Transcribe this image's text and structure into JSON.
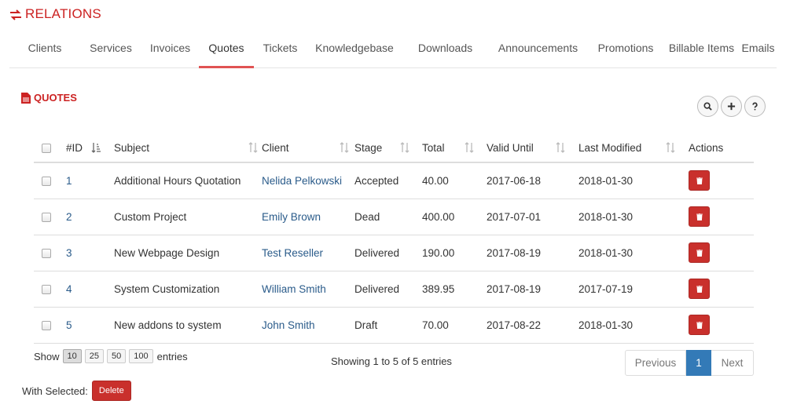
{
  "header": {
    "title": "RELATIONS",
    "icon": "exchange-icon",
    "accent": "#cc2222"
  },
  "tabs": [
    {
      "label": "Clients"
    },
    {
      "label": "Services"
    },
    {
      "label": "Invoices"
    },
    {
      "label": "Quotes",
      "active": true
    },
    {
      "label": "Tickets"
    },
    {
      "label": "Knowledgebase"
    },
    {
      "label": "Downloads"
    },
    {
      "label": "Announcements"
    },
    {
      "label": "Promotions"
    },
    {
      "label": "Billable Items"
    },
    {
      "label": "Emails"
    }
  ],
  "section": {
    "title": "QUOTES",
    "icon": "file-icon"
  },
  "tools": [
    {
      "icon": "search-icon"
    },
    {
      "icon": "plus-icon"
    },
    {
      "icon": "help-icon"
    }
  ],
  "table": {
    "columns": [
      "#ID",
      "Subject",
      "Client",
      "Stage",
      "Total",
      "Valid Until",
      "Last Modified",
      "Actions"
    ],
    "rows": [
      {
        "id": "1",
        "subject": "Additional Hours Quotation",
        "client": "Nelida Pelkowski",
        "stage": "Accepted",
        "total": "40.00",
        "valid_until": "2017-06-18",
        "last_modified": "2018-01-30"
      },
      {
        "id": "2",
        "subject": "Custom Project",
        "client": "Emily Brown",
        "stage": "Dead",
        "total": "400.00",
        "valid_until": "2017-07-01",
        "last_modified": "2018-01-30"
      },
      {
        "id": "3",
        "subject": "New Webpage Design",
        "client": "Test Reseller",
        "stage": "Delivered",
        "total": "190.00",
        "valid_until": "2017-08-19",
        "last_modified": "2018-01-30"
      },
      {
        "id": "4",
        "subject": "System Customization",
        "client": "William Smith",
        "stage": "Delivered",
        "total": "389.95",
        "valid_until": "2017-08-19",
        "last_modified": "2017-07-19"
      },
      {
        "id": "5",
        "subject": "New addons to system",
        "client": "John Smith",
        "stage": "Draft",
        "total": "70.00",
        "valid_until": "2017-08-22",
        "last_modified": "2018-01-30"
      }
    ]
  },
  "length_menu": {
    "before": "Show",
    "after": "entries",
    "options": [
      "10",
      "25",
      "50",
      "100"
    ],
    "selected": "10"
  },
  "info": "Showing 1 to 5 of 5 entries",
  "pagination": {
    "previous": "Previous",
    "current": "1",
    "next": "Next"
  },
  "bulk": {
    "label": "With Selected:",
    "delete_label": "Delete"
  },
  "colors": {
    "danger": "#c9302c",
    "primary": "#337ab7",
    "link": "#2a5b8a"
  }
}
